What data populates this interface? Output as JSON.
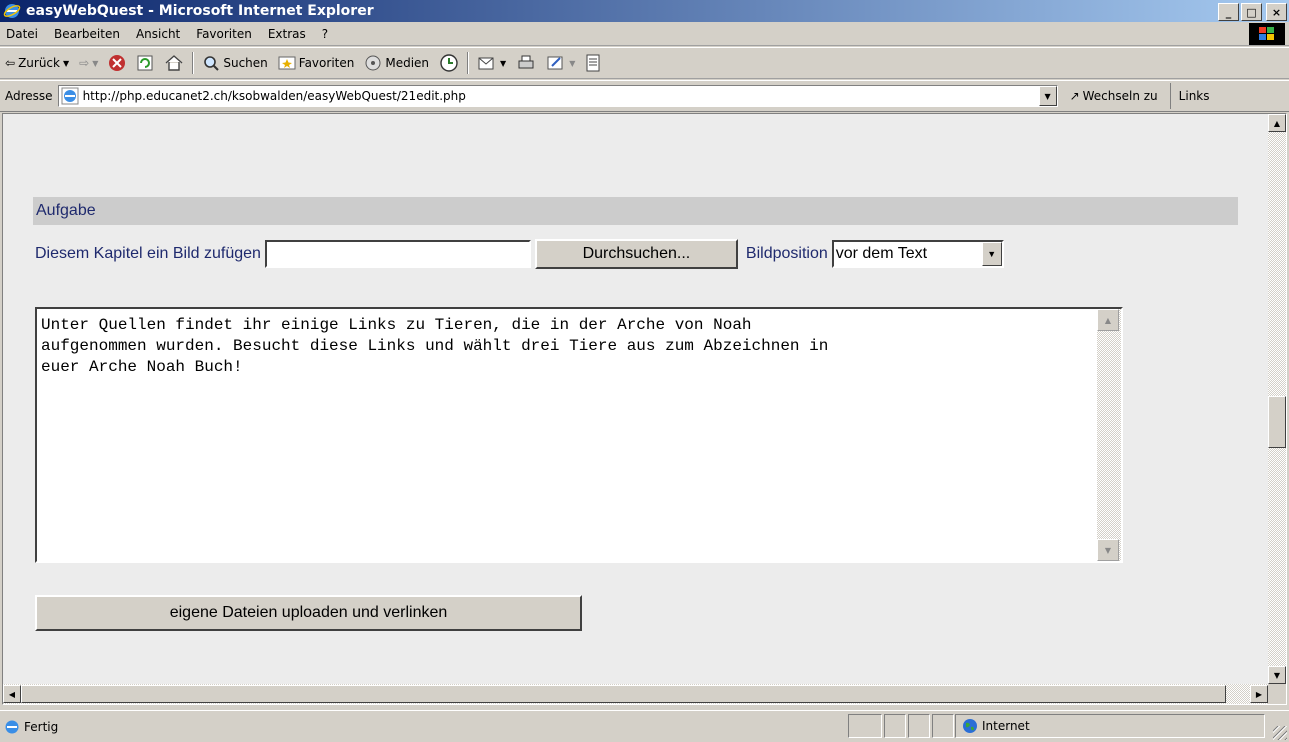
{
  "window": {
    "title": "easyWebQuest - Microsoft Internet Explorer",
    "minimize": "_",
    "maximize": "□",
    "close": "×"
  },
  "menu": [
    "Datei",
    "Bearbeiten",
    "Ansicht",
    "Favoriten",
    "Extras",
    "?"
  ],
  "toolbar": {
    "back": "Zurück",
    "search": "Suchen",
    "favorites": "Favoriten",
    "media": "Medien"
  },
  "address": {
    "label": "Adresse",
    "url": "http://php.educanet2.ch/ksobwalden/easyWebQuest/21edit.php",
    "go": "Wechseln zu",
    "links": "Links"
  },
  "page": {
    "section_title": "Aufgabe",
    "image_label": "Diesem Kapitel ein Bild zufügen",
    "file_value": "",
    "browse_label": "Durchsuchen...",
    "position_label": "Bildposition",
    "position_value": "vor dem Text",
    "text_content": "Unter Quellen findet ihr einige Links zu Tieren, die in der Arche von Noah\naufgenommen wurden. Besucht diese Links und wählt drei Tiere aus zum Abzeichnen in\neuer Arche Noah Buch!",
    "upload_label": "eigene Dateien uploaden und verlinken"
  },
  "status": {
    "text": "Fertig",
    "zone": "Internet"
  },
  "colors": {
    "label_text": "#1f2a6e",
    "section_bg": "#cccccc",
    "chrome": "#d4d0c8"
  }
}
